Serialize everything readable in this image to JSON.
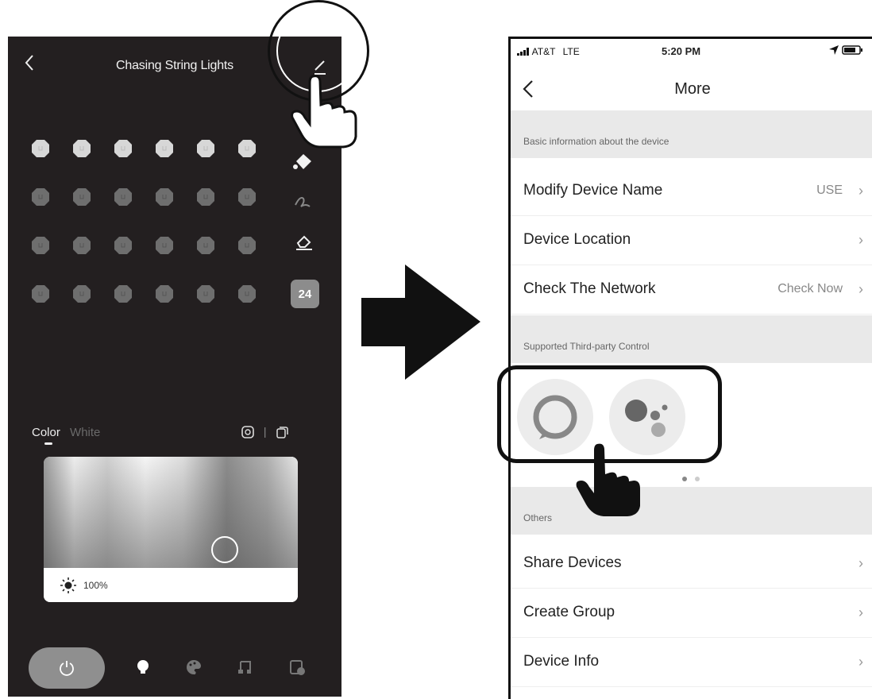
{
  "left_screen": {
    "title": "Chasing String Lights",
    "back_icon": "chevron-left-icon",
    "edit_icon": "edit-icon",
    "bulbs": {
      "rows": 4,
      "columns": 6,
      "on_states": [
        [
          true,
          true,
          true,
          true,
          true,
          true
        ],
        [
          false,
          false,
          false,
          false,
          false,
          false
        ],
        [
          false,
          false,
          false,
          false,
          false,
          false
        ],
        [
          false,
          false,
          false,
          false,
          false,
          false
        ]
      ]
    },
    "tools": [
      "paint-bucket-icon",
      "brush-icon",
      "eraser-icon"
    ],
    "selected_count": "24",
    "mode_tabs": {
      "color": "Color",
      "white": "White"
    },
    "mode_icons": [
      "color-mode-icon",
      "copy-icon"
    ],
    "brightness": "100%",
    "nav_icons": [
      "power-icon",
      "bulb-icon",
      "palette-icon",
      "music-icon",
      "schedule-icon"
    ],
    "colors": {
      "background": "#231f20",
      "bulb_on": "#d7d7d7",
      "bulb_off": "#6e6e6e",
      "badge": "#8c8c8c"
    }
  },
  "right_screen": {
    "status_bar": {
      "carrier": "AT&T",
      "network": "LTE",
      "time": "5:20 PM"
    },
    "title": "More",
    "sections": {
      "basic": "Basic information about the device",
      "third_party": "Supported Third-party Control",
      "others": "Others"
    },
    "basic_rows": [
      {
        "label": "Modify Device Name",
        "value": "USE"
      },
      {
        "label": "Device Location",
        "value": ""
      },
      {
        "label": "Check The Network",
        "value": "Check Now"
      }
    ],
    "third_party_icons": [
      "alexa-icon",
      "google-assistant-icon"
    ],
    "page_dots": 2,
    "other_rows": [
      {
        "label": "Share Devices"
      },
      {
        "label": "Create Group"
      },
      {
        "label": "Device Info"
      }
    ],
    "colors": {
      "section_bg": "#e9e9e9",
      "icon_bg": "#ececec"
    }
  },
  "annotations": {
    "arrow_icon": "right-arrow-icon",
    "hand_icon": "pointing-hand-icon"
  }
}
